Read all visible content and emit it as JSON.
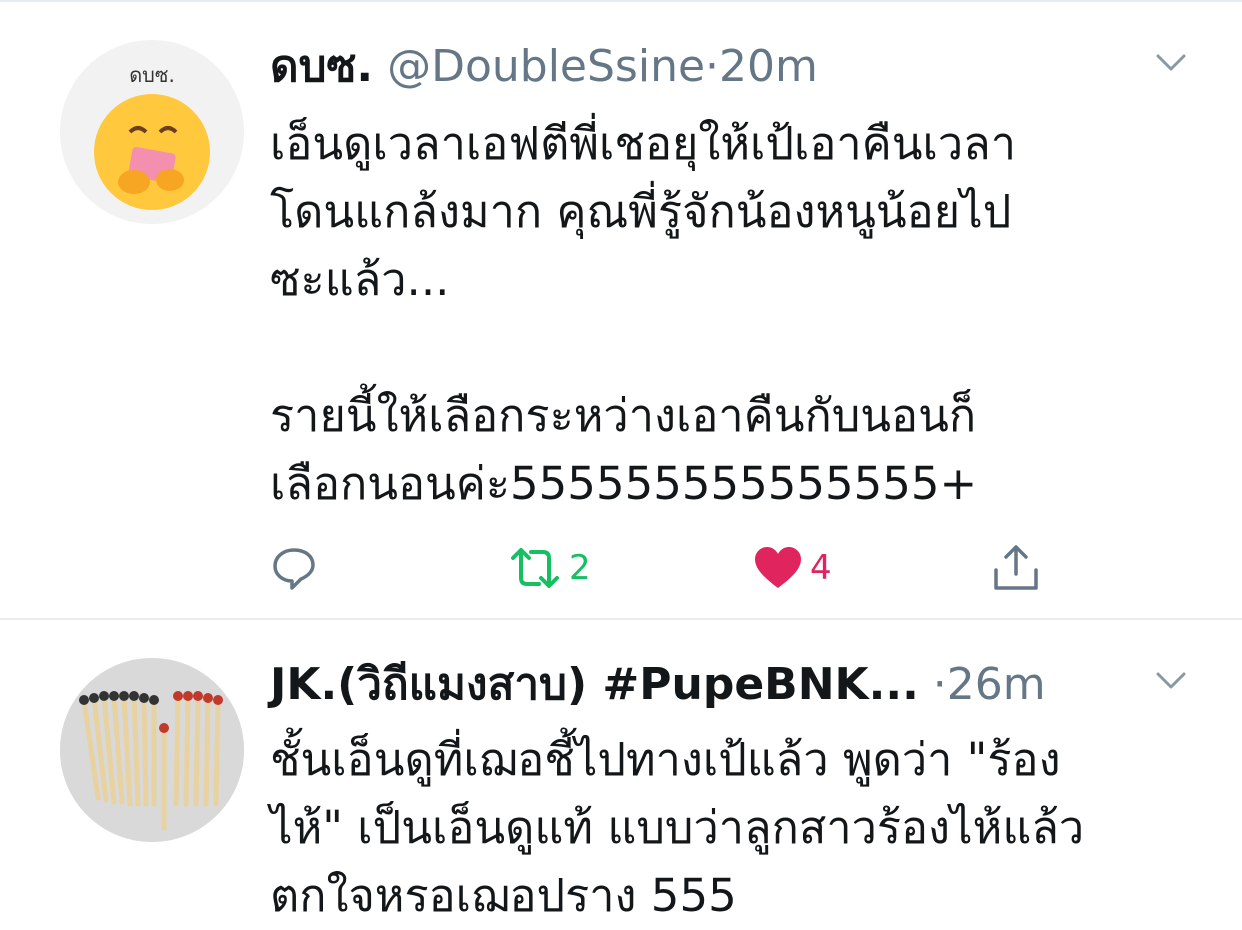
{
  "tweets": [
    {
      "display_name": "ดบซ.",
      "handle": "@DoubleSsine",
      "separator": "·",
      "time": "20m",
      "avatar_text": "ดบซ.",
      "body": "เอ็นดูเวลาเอฟตีพี่เชอยุให้เป้เอาคืนเวลา\nโดนแกล้งมาก คุณพี่รู้จักน้องหนูน้อยไป\nซะแล้ว...\n\nรายนี้ให้เลือกระหว่างเอาคืนกับนอนก็\nเลือกนอนค่ะ555555555555555+",
      "retweet_count": "2",
      "like_count": "4"
    },
    {
      "display_name": "JK.(วิถีแมงสาบ) #PupeBNK...",
      "handle": "",
      "separator": "·",
      "time": "26m",
      "body": "ชั้นเอ็นดูที่เฌอชี้ไปทางเป้แล้ว พูดว่า \"ร้อง\nไห้\" เป็นเอ็นดูแท้ แบบว่าลูกสาวร้องไห้แล้ว\nตกใจหรอเฌอปราง 555"
    }
  ],
  "colors": {
    "retweet_active": "#17bf63",
    "like_active": "#e0245e",
    "secondary_text": "#657786",
    "primary_text": "#14171a",
    "divider": "#e6ecf0"
  },
  "icons": [
    "reply-icon",
    "retweet-icon",
    "heart-icon",
    "share-icon",
    "chevron-down-icon"
  ]
}
